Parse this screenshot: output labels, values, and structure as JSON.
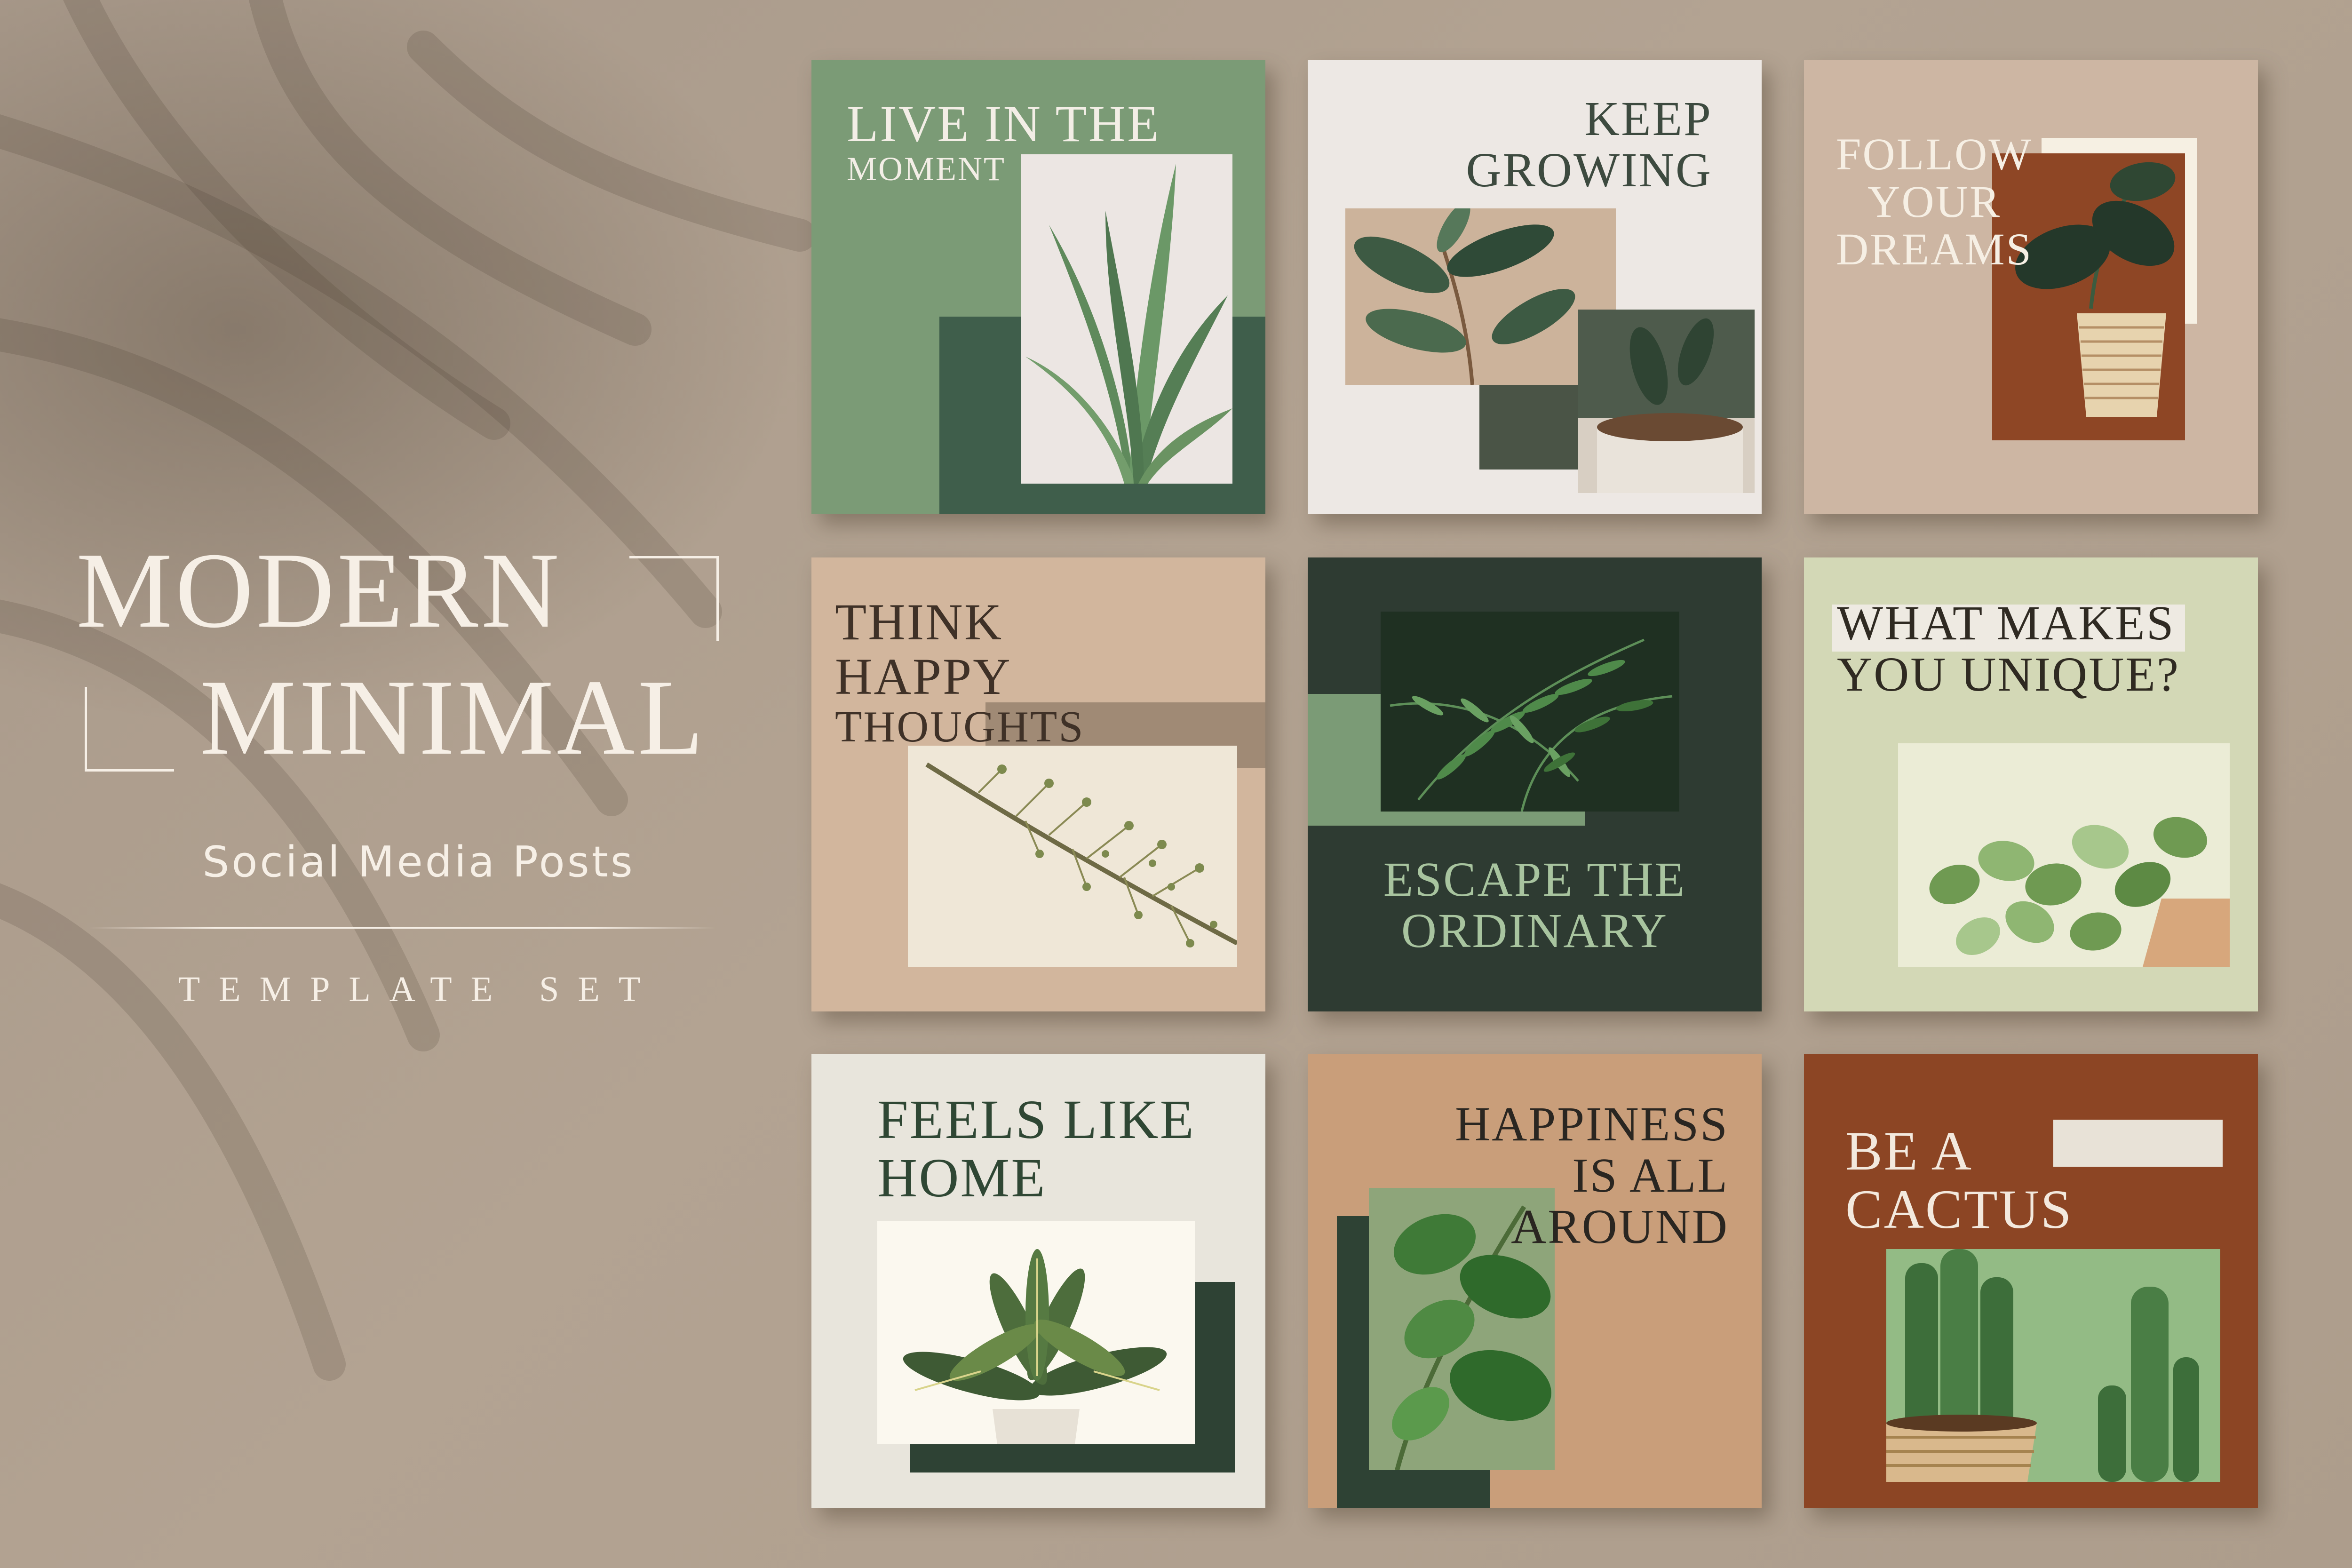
{
  "title": {
    "line1": "MODERN",
    "line2": "MINIMAL",
    "subtitle": "Social Media Posts",
    "caption": "TEMPLATE SET"
  },
  "cards": [
    {
      "lines": [
        "LIVE IN THE",
        "MOMENT"
      ],
      "image": "snake-plant-photo",
      "bg": "#7b9b76"
    },
    {
      "lines": [
        "KEEP",
        "GROWING"
      ],
      "image": "rubber-plant-photo",
      "bg": "#ede8e4"
    },
    {
      "lines": [
        "FOLLOW",
        "YOUR",
        "DREAMS"
      ],
      "image": "alocasia-pot-photo",
      "bg": "#cdb6a3"
    },
    {
      "lines": [
        "THINK",
        "HAPPY",
        "THOUGHTS"
      ],
      "image": "dried-branch-photo",
      "bg": "#d2b69d"
    },
    {
      "lines": [
        "ESCAPE THE",
        "ORDINARY"
      ],
      "image": "fern-photo",
      "bg": "#2e3b32"
    },
    {
      "lines": [
        "WHAT MAKES",
        "YOU UNIQUE?"
      ],
      "image": "pothos-photo",
      "bg": "#d3d8b6"
    },
    {
      "lines": [
        "FEELS LIKE",
        "HOME"
      ],
      "image": "potted-plant-photo",
      "bg": "#e8e5dc"
    },
    {
      "lines": [
        "HAPPINESS",
        "IS ALL",
        "AROUND"
      ],
      "image": "leaf-closeup-photo",
      "bg": "#c99e7a"
    },
    {
      "lines": [
        "BE A",
        "CACTUS"
      ],
      "image": "cactus-photo",
      "bg": "#8c4524"
    }
  ]
}
